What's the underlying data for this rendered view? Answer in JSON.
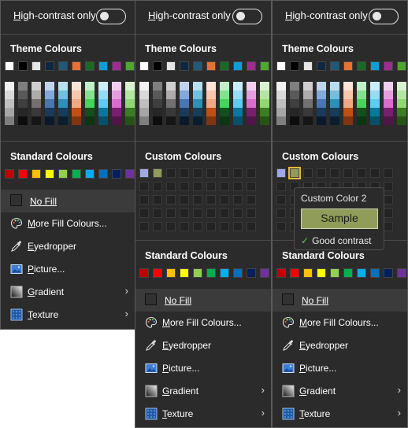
{
  "high_contrast_label_prefix": "H",
  "high_contrast_label_rest": "igh-contrast only",
  "theme_colours_heading": "Theme Colours",
  "standard_colours_heading": "Standard Colours",
  "custom_colours_heading": "Custom Colours",
  "theme_colors": [
    "#ffffff",
    "#000000",
    "#e7e6e6",
    "#0e2841",
    "#1f5a78",
    "#e97132",
    "#196b24",
    "#0f9ed5",
    "#a02b93",
    "#4ea72e"
  ],
  "theme_shades": [
    [
      "#f2f2f2",
      "#d9d9d9",
      "#bfbfbf",
      "#a6a6a6",
      "#7f7f7f"
    ],
    [
      "#7f7f7f",
      "#595959",
      "#3f3f3f",
      "#262626",
      "#0d0d0d"
    ],
    [
      "#d0cece",
      "#afabab",
      "#757070",
      "#3a3838",
      "#171616"
    ],
    [
      "#c0d4ec",
      "#82a9d9",
      "#4a76b0",
      "#1b3959",
      "#0a1a2c"
    ],
    [
      "#b8dff0",
      "#72bfe1",
      "#2e90b8",
      "#163d5b",
      "#0a1e2d"
    ],
    [
      "#fbe3d6",
      "#f7c7ac",
      "#f1a983",
      "#c04f15",
      "#80350e"
    ],
    [
      "#c1f0c8",
      "#83e28e",
      "#48d35b",
      "#124f1a",
      "#0c3511"
    ],
    [
      "#caeefb",
      "#95dcf7",
      "#61cbf3",
      "#0b76a0",
      "#074f6a"
    ],
    [
      "#f2cfee",
      "#e59edd",
      "#d86dcd",
      "#781f6f",
      "#501549"
    ],
    [
      "#d9f2d0",
      "#b4e5a2",
      "#8fd873",
      "#3b7d23",
      "#275317"
    ]
  ],
  "standard_colors": [
    "#c00000",
    "#ff0000",
    "#ffc000",
    "#ffff00",
    "#92d050",
    "#00b050",
    "#00b0f0",
    "#0070c0",
    "#002060",
    "#7030a0"
  ],
  "custom_colors_p2": [
    "#9fa8e6",
    "#8f9c5a"
  ],
  "custom_colors_p3": [
    "#9fa8e6",
    "#8f9c5a"
  ],
  "menu": {
    "no_fill_prefix": "N",
    "no_fill_rest": "o Fill",
    "more_fill_prefix": "M",
    "more_fill_rest": "ore Fill Colours...",
    "eyedropper_prefix": "E",
    "eyedropper_rest": "yedropper",
    "picture_prefix": "P",
    "picture_rest": "icture...",
    "gradient_prefix": "G",
    "gradient_rest": "radient",
    "texture_prefix": "T",
    "texture_rest": "exture"
  },
  "tooltip": {
    "title": "Custom Color 2",
    "sample": "Sample",
    "contrast": "Good contrast",
    "sample_color": "#8f9c5a"
  }
}
